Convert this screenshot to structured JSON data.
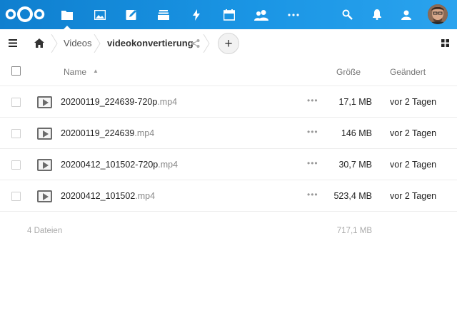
{
  "header": {
    "apps": [
      {
        "name": "files-icon",
        "active": true
      },
      {
        "name": "photos-icon",
        "active": false
      },
      {
        "name": "notes-icon",
        "active": false
      },
      {
        "name": "deck-icon",
        "active": false
      },
      {
        "name": "activity-icon",
        "active": false
      },
      {
        "name": "calendar-icon",
        "active": false
      },
      {
        "name": "contacts-icon",
        "active": false
      },
      {
        "name": "more-apps-icon",
        "active": false
      }
    ],
    "right": [
      "search-icon",
      "notifications-icon",
      "contacts-menu-icon"
    ]
  },
  "breadcrumb": {
    "home_icon": "home-icon",
    "crumbs": [
      "Videos",
      "videokonvertierung"
    ],
    "add_label": "+"
  },
  "table": {
    "col_name": "Name",
    "col_size": "Größe",
    "col_modified": "Geändert",
    "rows": [
      {
        "base": "20200119_224639-720p",
        "ext": ".mp4",
        "size": "17,1 MB",
        "modified": "vor 2 Tagen"
      },
      {
        "base": "20200119_224639",
        "ext": ".mp4",
        "size": "146 MB",
        "modified": "vor 2 Tagen"
      },
      {
        "base": "20200412_101502-720p",
        "ext": ".mp4",
        "size": "30,7 MB",
        "modified": "vor 2 Tagen"
      },
      {
        "base": "20200412_101502",
        "ext": ".mp4",
        "size": "523,4 MB",
        "modified": "vor 2 Tagen"
      }
    ],
    "summary_count": "4 Dateien",
    "summary_size": "717,1 MB",
    "row_actions": "•••"
  },
  "colors": {
    "header_start": "#0f7fcf",
    "header_end": "#2aa3ee"
  }
}
